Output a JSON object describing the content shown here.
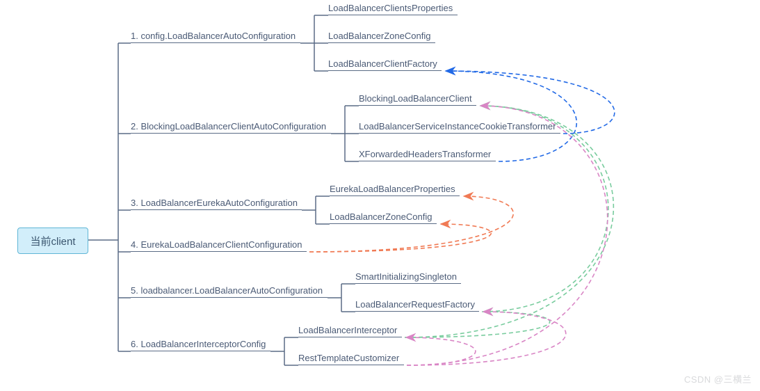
{
  "root": {
    "label": "当前client"
  },
  "watermark": "CSDN @三横兰",
  "groups": [
    {
      "label": "1. config.LoadBalancerAutoConfiguration",
      "children": [
        {
          "id": "lbcp",
          "label": "LoadBalancerClientsProperties"
        },
        {
          "id": "lbz1",
          "label": "LoadBalancerZoneConfig"
        },
        {
          "id": "lbcf",
          "label": "LoadBalancerClientFactory"
        }
      ]
    },
    {
      "label": "2. BlockingLoadBalancerClientAutoConfiguration",
      "children": [
        {
          "id": "block",
          "label": "BlockingLoadBalancerClient"
        },
        {
          "id": "cookie",
          "label": "LoadBalancerServiceInstanceCookieTransformer"
        },
        {
          "id": "xfwd",
          "label": "XForwardedHeadersTransformer"
        }
      ]
    },
    {
      "label": "3. LoadBalancerEurekaAutoConfiguration",
      "children": [
        {
          "id": "eurekaProps",
          "label": "EurekaLoadBalancerProperties"
        },
        {
          "id": "lbz2",
          "label": "LoadBalancerZoneConfig"
        }
      ]
    },
    {
      "label": "4. EurekaLoadBalancerClientConfiguration",
      "children": []
    },
    {
      "label": "5. loadbalancer.LoadBalancerAutoConfiguration",
      "children": [
        {
          "id": "smart",
          "label": "SmartInitializingSingleton"
        },
        {
          "id": "reqf",
          "label": "LoadBalancerRequestFactory"
        }
      ]
    },
    {
      "label": "6. LoadBalancerInterceptorConfig",
      "children": [
        {
          "id": "intcp",
          "label": "LoadBalancerInterceptor"
        },
        {
          "id": "restc",
          "label": "RestTemplateCustomizer"
        }
      ]
    }
  ],
  "arrows": [
    {
      "from": "cookie",
      "to": "lbcf",
      "color": "#2169e6"
    },
    {
      "from": "xfwd",
      "to": "lbcf",
      "color": "#2169e6"
    },
    {
      "from": "g4",
      "to": "eurekaProps",
      "color": "#f07a54"
    },
    {
      "from": "g4",
      "to": "lbz2",
      "color": "#f07a54"
    },
    {
      "from": "reqf",
      "to": "block",
      "color": "#79cc9e"
    },
    {
      "from": "intcp",
      "to": "block",
      "color": "#79cc9e"
    },
    {
      "from": "intcp",
      "to": "reqf",
      "color": "#79cc9e"
    },
    {
      "from": "restc",
      "to": "block",
      "color": "#d985c5"
    },
    {
      "from": "restc",
      "to": "intcp",
      "color": "#d985c5"
    },
    {
      "from": "restc",
      "to": "reqf",
      "color": "#d985c5"
    }
  ],
  "colors": {
    "line": "#5a6b85",
    "blue": "#2169e6",
    "orange": "#f07a54",
    "green": "#79cc9e",
    "pink": "#d985c5"
  }
}
